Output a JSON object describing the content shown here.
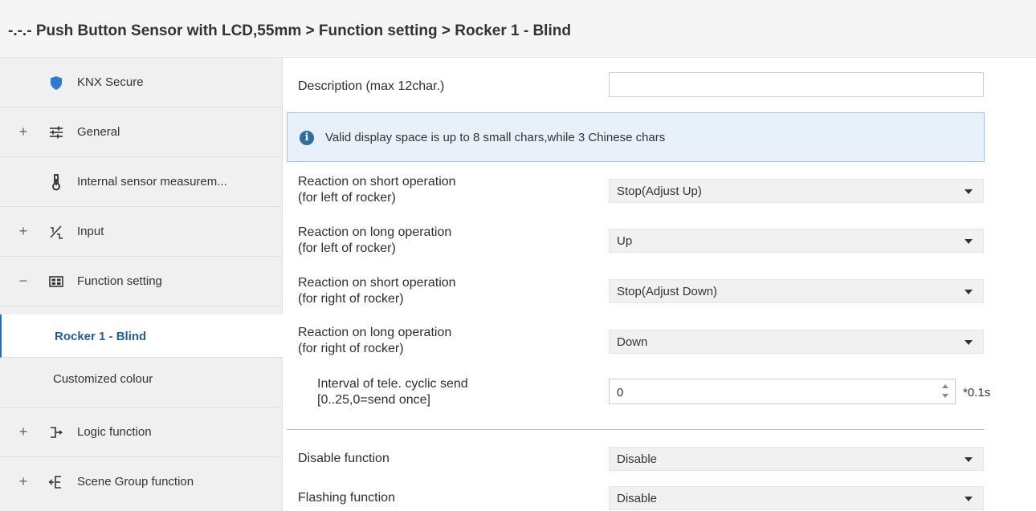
{
  "title": "-.-.- Push Button Sensor with LCD,55mm > Function setting > Rocker 1 - Blind",
  "sidebar": {
    "items": [
      {
        "expander": "",
        "icon": "shield-icon",
        "label": "KNX Secure"
      },
      {
        "expander": "+",
        "icon": "sliders-icon",
        "label": "General"
      },
      {
        "expander": "",
        "icon": "thermometer-icon",
        "label": "Internal sensor measurem..."
      },
      {
        "expander": "+",
        "icon": "input-icon",
        "label": "Input"
      },
      {
        "expander": "−",
        "icon": "grid-icon",
        "label": "Function setting"
      },
      {
        "expander": "",
        "icon": "",
        "label": "Rocker 1 - Blind"
      },
      {
        "expander": "",
        "icon": "",
        "label": "Customized colour"
      },
      {
        "expander": "+",
        "icon": "logic-icon",
        "label": "Logic function"
      },
      {
        "expander": "+",
        "icon": "scene-icon",
        "label": "Scene Group function"
      }
    ]
  },
  "form": {
    "description": {
      "label": "Description (max 12char.)",
      "value": ""
    },
    "info": "Valid display space is up to 8 small chars,while 3 Chinese chars",
    "short_left": {
      "label1": "Reaction on short operation",
      "label2": "(for left of rocker)",
      "value": "Stop(Adjust Up)"
    },
    "long_left": {
      "label1": "Reaction on long operation",
      "label2": "(for left of rocker)",
      "value": "Up"
    },
    "short_right": {
      "label1": "Reaction on short operation",
      "label2": "(for right of rocker)",
      "value": "Stop(Adjust Down)"
    },
    "long_right": {
      "label1": "Reaction on long operation",
      "label2": "(for right of rocker)",
      "value": "Down"
    },
    "interval": {
      "label1": "Interval of tele. cyclic send",
      "label2": "[0..25,0=send once]",
      "value": "0",
      "unit": "*0.1s"
    },
    "disable": {
      "label": "Disable function",
      "value": "Disable"
    },
    "flashing": {
      "label": "Flashing function",
      "value": "Disable"
    }
  },
  "colors": {
    "accent": "#1f6fbf",
    "info_bg": "#e8f1f9",
    "info_border": "#9ec2e3"
  }
}
